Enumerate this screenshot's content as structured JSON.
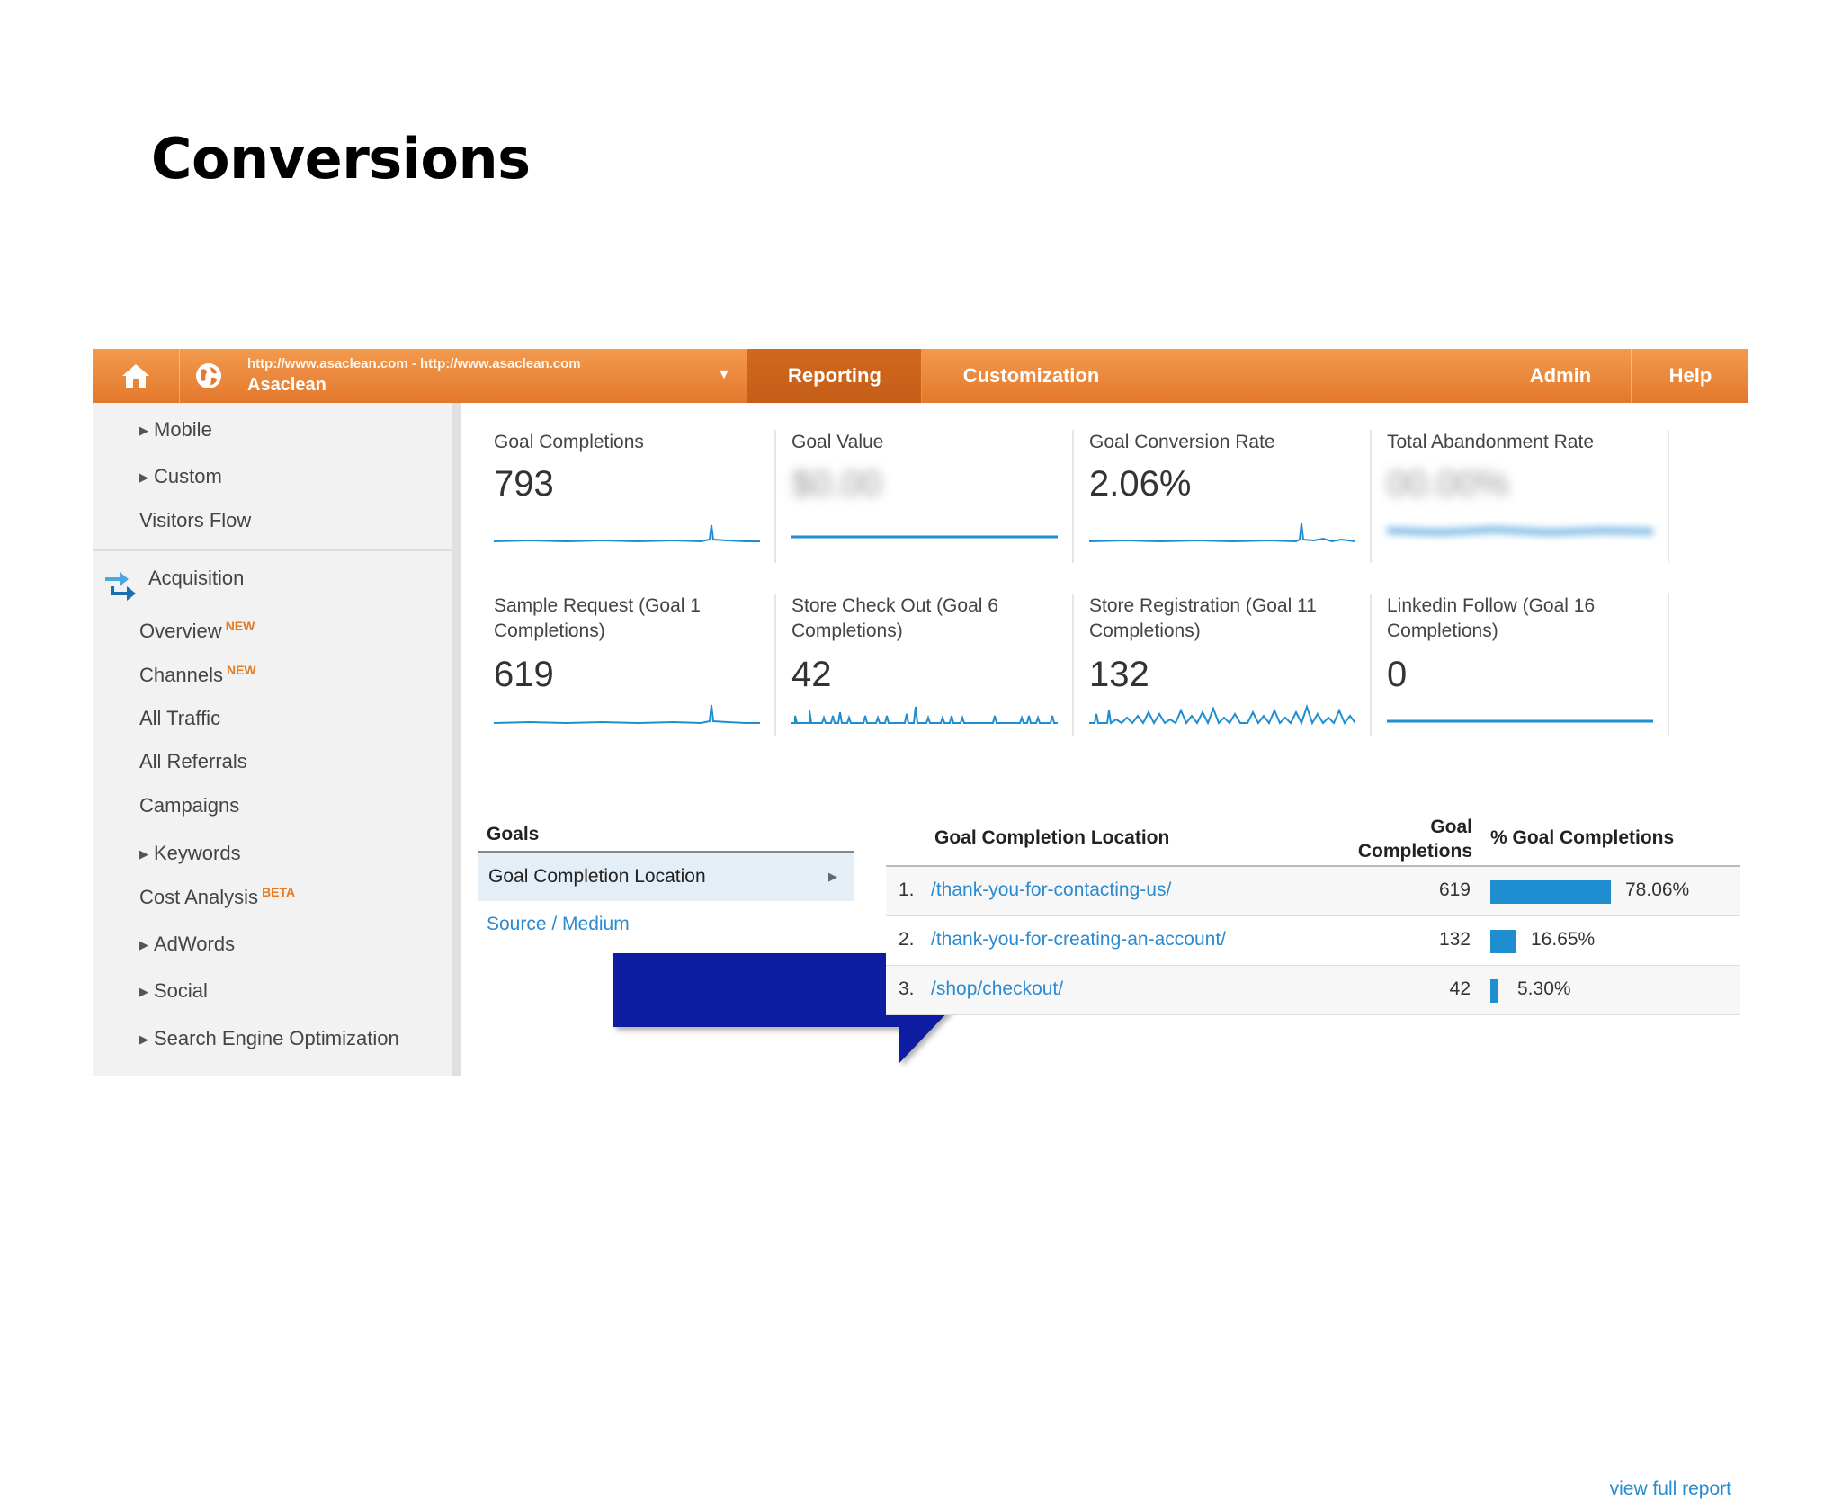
{
  "slide": {
    "title": "Conversions"
  },
  "topbar": {
    "site_url": "http://www.asaclean.com - http://www.asaclean.com",
    "site_name": "Asaclean",
    "tabs": [
      "Reporting",
      "Customization",
      "Admin",
      "Help"
    ],
    "active_tab": "Reporting",
    "colors": {
      "bar": "#e8803a",
      "active": "#c9621b"
    }
  },
  "sidebar": {
    "items": [
      {
        "label": "Mobile",
        "expandable": true
      },
      {
        "label": "Custom",
        "expandable": true
      },
      {
        "label": "Visitors Flow",
        "expandable": false
      },
      {
        "label": "Acquisition",
        "section": true
      },
      {
        "label": "Overview",
        "badge": "NEW"
      },
      {
        "label": "Channels",
        "badge": "NEW"
      },
      {
        "label": "All Traffic"
      },
      {
        "label": "All Referrals"
      },
      {
        "label": "Campaigns"
      },
      {
        "label": "Keywords",
        "expandable": true
      },
      {
        "label": "Cost Analysis",
        "badge": "BETA"
      },
      {
        "label": "AdWords",
        "expandable": true
      },
      {
        "label": "Social",
        "expandable": true
      },
      {
        "label": "Search Engine Optimization",
        "expandable": true
      }
    ]
  },
  "metrics": [
    {
      "label": "Goal Completions",
      "value": "793"
    },
    {
      "label": "Goal Value",
      "value": "$0.00"
    },
    {
      "label": "Goal Conversion Rate",
      "value": "2.06%"
    },
    {
      "label": "Total Abandonment Rate",
      "value": "00.00%"
    },
    {
      "label": "Sample Request (Goal 1 Completions)",
      "value": "619"
    },
    {
      "label": "Store Check Out (Goal 6 Completions)",
      "value": "42"
    },
    {
      "label": "Store Registration (Goal 11 Completions)",
      "value": "132"
    },
    {
      "label": "Linkedin Follow (Goal 16 Completions)",
      "value": "0"
    }
  ],
  "goals": {
    "heading": "Goals",
    "selected": "Goal Completion Location",
    "other": "Source / Medium"
  },
  "table": {
    "headers": [
      "Goal Completion Location",
      "Goal Completions",
      "% Goal Completions"
    ],
    "rows": [
      {
        "num": "1.",
        "location": "/thank-you-for-contacting-us/",
        "completions": "619",
        "percent": "78.06%",
        "fraction": 0.7806
      },
      {
        "num": "2.",
        "location": "/thank-you-for-creating-an-account/",
        "completions": "132",
        "percent": "16.65%",
        "fraction": 0.1665
      },
      {
        "num": "3.",
        "location": "/shop/checkout/",
        "completions": "42",
        "percent": "5.30%",
        "fraction": 0.053
      }
    ],
    "footer_link": "view full report",
    "bar_color": "#1f8ed0"
  },
  "annotation": {
    "arrow_color": "#0a1fa0"
  }
}
